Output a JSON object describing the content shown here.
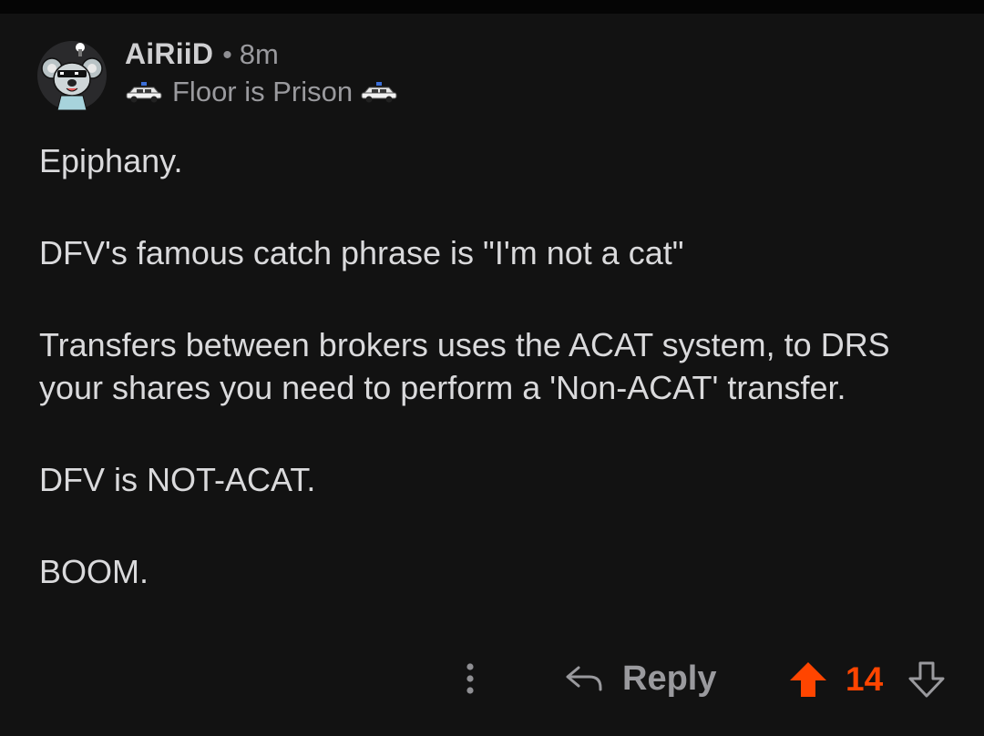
{
  "comment": {
    "username": "AiRiiD",
    "separator": "•",
    "age": "8m",
    "flair": {
      "text": "Floor is Prison",
      "left_icon": "police-car-icon",
      "right_icon": "police-car-icon"
    },
    "avatar_icon": "snoo-koala-avatar-icon",
    "body_paragraphs": [
      "Epiphany.",
      "DFV's famous catch phrase is \"I'm not a cat\"",
      "Transfers between brokers uses the ACAT system, to DRS your shares you need to perform a 'Non-ACAT' transfer.",
      "DFV is NOT-ACAT.",
      "BOOM."
    ]
  },
  "actions": {
    "more_icon": "more-vertical-icon",
    "reply_icon": "reply-arrow-icon",
    "reply_label": "Reply",
    "upvote_icon": "upvote-arrow-icon",
    "score": "14",
    "downvote_icon": "downvote-arrow-icon"
  },
  "colors": {
    "background": "#121212",
    "text_primary": "#dadadc",
    "text_secondary": "#9a9a9e",
    "upvote_active": "#ff4500"
  }
}
